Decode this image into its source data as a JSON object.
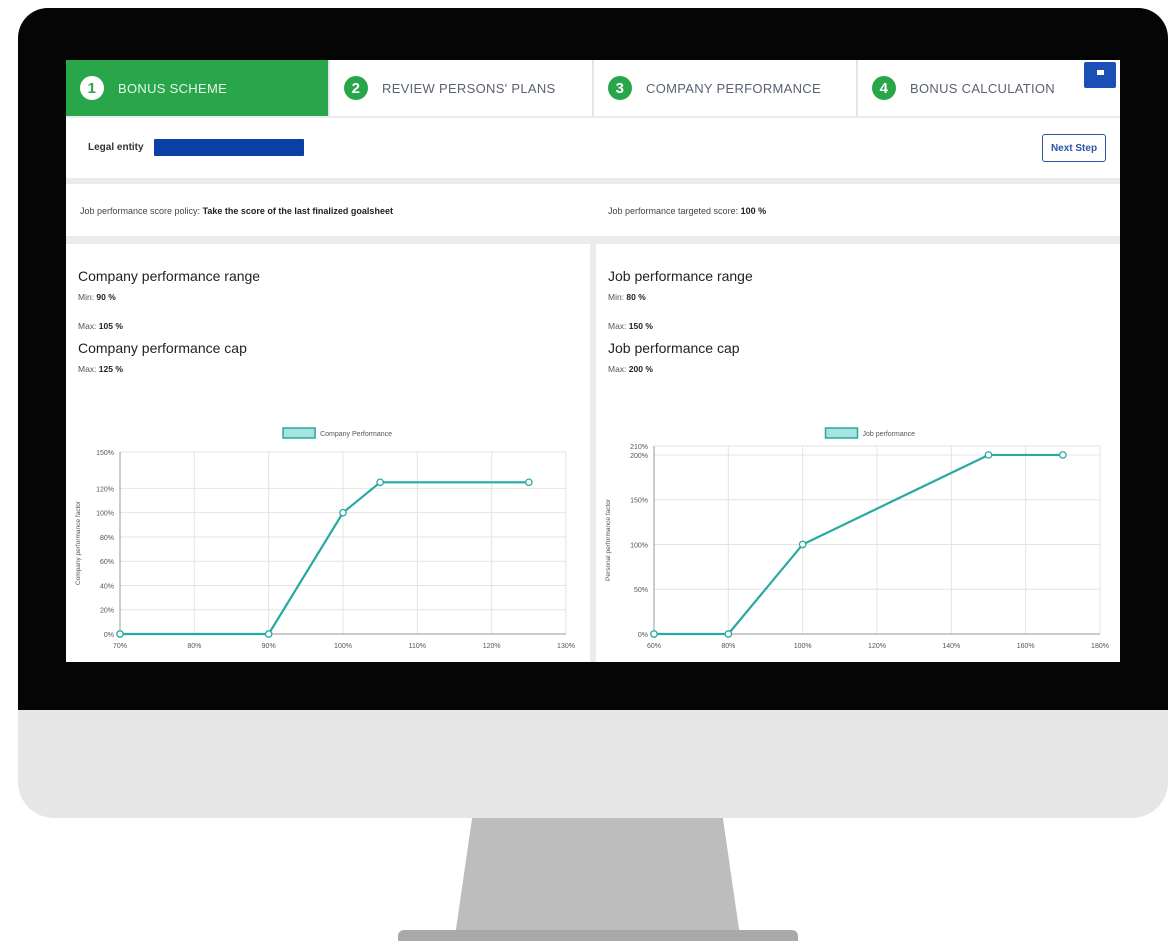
{
  "steps": [
    {
      "num": "1",
      "label": "BONUS SCHEME"
    },
    {
      "num": "2",
      "label": "REVIEW PERSONS' PLANS"
    },
    {
      "num": "3",
      "label": "COMPANY PERFORMANCE"
    },
    {
      "num": "4",
      "label": "BONUS CALCULATION"
    }
  ],
  "entity": {
    "label": "Legal entity"
  },
  "next_step_label": "Next Step",
  "policy": {
    "left_label": "Job performance score policy: ",
    "left_value": "Take the score of the last finalized goalsheet",
    "right_label": "Job performance targeted score: ",
    "right_value": "100 %"
  },
  "company": {
    "range_title": "Company performance range",
    "min_label": "Min: ",
    "min_value": "90 %",
    "max_label": "Max: ",
    "max_value": "105 %",
    "cap_title": "Company performance cap",
    "cap_label": "Max: ",
    "cap_value": "125 %"
  },
  "job": {
    "range_title": "Job performance range",
    "min_label": "Min: ",
    "min_value": "80 %",
    "max_label": "Max: ",
    "max_value": "150 %",
    "cap_title": "Job performance cap",
    "cap_label": "Max: ",
    "cap_value": "200 %"
  },
  "colors": {
    "line": "#27aaa0",
    "fill": "#a7e3df",
    "green": "#2aa64a"
  },
  "chart_data": [
    {
      "type": "line",
      "title": "",
      "xlabel": "",
      "ylabel": "Company performance factor",
      "legend": "Company Performance",
      "legend_position": "top",
      "xlim": [
        70,
        130
      ],
      "ylim": [
        0,
        150
      ],
      "x_ticks": [
        70,
        80,
        90,
        100,
        110,
        120,
        130
      ],
      "x_tick_labels": [
        "70%",
        "80%",
        "90%",
        "100%",
        "110%",
        "120%",
        "130%"
      ],
      "y_ticks": [
        0,
        20,
        40,
        60,
        80,
        100,
        120,
        150
      ],
      "y_tick_labels": [
        "0%",
        "20%",
        "40%",
        "60%",
        "80%",
        "100%",
        "120%",
        "150%"
      ],
      "series": [
        {
          "name": "Company Performance",
          "x": [
            70,
            90,
            100,
            105,
            125
          ],
          "y": [
            0,
            0,
            100,
            125,
            125
          ]
        }
      ]
    },
    {
      "type": "line",
      "title": "",
      "xlabel": "",
      "ylabel": "Personal performance factor",
      "legend": "Job performance",
      "legend_position": "top",
      "xlim": [
        60,
        180
      ],
      "ylim": [
        0,
        210
      ],
      "x_ticks": [
        60,
        80,
        100,
        120,
        140,
        160,
        180
      ],
      "x_tick_labels": [
        "60%",
        "80%",
        "100%",
        "120%",
        "140%",
        "160%",
        "180%"
      ],
      "y_ticks": [
        0,
        50,
        100,
        150,
        200,
        210
      ],
      "y_tick_labels": [
        "0%",
        "50%",
        "100%",
        "150%",
        "200%",
        "210%"
      ],
      "series": [
        {
          "name": "Job performance",
          "x": [
            60,
            80,
            100,
            150,
            170
          ],
          "y": [
            0,
            0,
            100,
            200,
            200
          ]
        }
      ]
    }
  ]
}
